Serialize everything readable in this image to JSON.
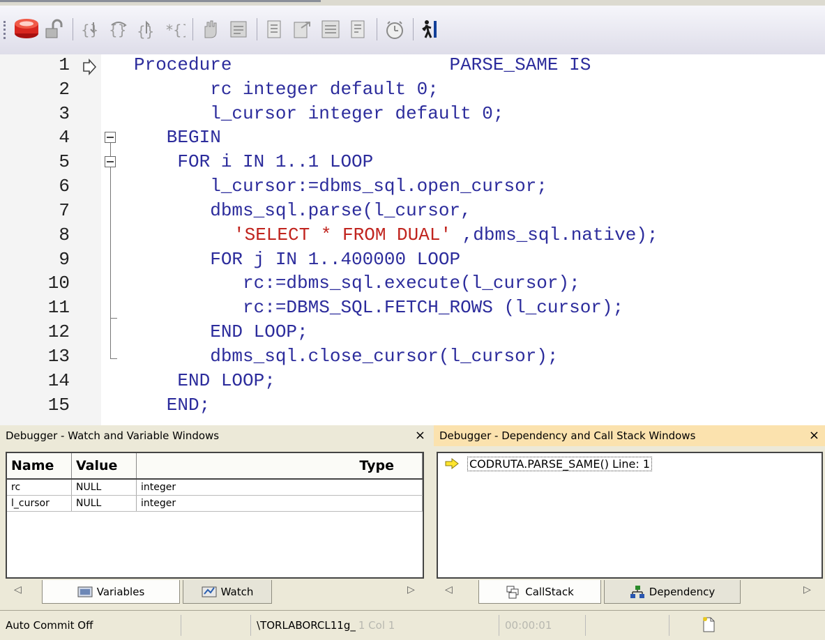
{
  "editor": {
    "lines": [
      {
        "num": "1",
        "text": "Procedure                    PARSE_SAME IS"
      },
      {
        "num": "2",
        "text": "       rc integer default 0;"
      },
      {
        "num": "3",
        "text": "       l_cursor integer default 0;"
      },
      {
        "num": "4",
        "text": "   BEGIN"
      },
      {
        "num": "5",
        "text": "    FOR i IN 1..1 LOOP"
      },
      {
        "num": "6",
        "text": "       l_cursor:=dbms_sql.open_cursor;"
      },
      {
        "num": "7",
        "text": "       dbms_sql.parse(l_cursor,"
      },
      {
        "num": "8",
        "string": "'SELECT * FROM DUAL'",
        "text": " ,dbms_sql.native);"
      },
      {
        "num": "9",
        "text": "       FOR j IN 1..400000 LOOP"
      },
      {
        "num": "10",
        "text": "          rc:=dbms_sql.execute(l_cursor);"
      },
      {
        "num": "11",
        "text": "          rc:=DBMS_SQL.FETCH_ROWS (l_cursor);"
      },
      {
        "num": "12",
        "text": "       END LOOP;"
      },
      {
        "num": "13",
        "text": "       dbms_sql.close_cursor(l_cursor);"
      },
      {
        "num": "14",
        "text": "    END LOOP;"
      },
      {
        "num": "15",
        "text": "   END;"
      }
    ]
  },
  "watch_panel": {
    "title": "Debugger  - Watch and Variable Windows",
    "close": "×",
    "columns": [
      "Name",
      "Value",
      "Type"
    ],
    "rows": [
      {
        "name": "rc",
        "value": "NULL",
        "type": "integer"
      },
      {
        "name": "l_cursor",
        "value": "NULL",
        "type": "integer"
      }
    ],
    "tabs": [
      "Variables",
      "Watch"
    ]
  },
  "callstack_panel": {
    "title": "Debugger - Dependency and Call Stack Windows",
    "close": "×",
    "entry": "CODRUTA.PARSE_SAME() Line: 1",
    "tabs": [
      "CallStack",
      "Dependency"
    ]
  },
  "status": {
    "commit": "Auto Commit Off",
    "connection": "\\TORLABORCL11g_",
    "position": "1 Col 1",
    "timer": "00:00:01"
  },
  "colors": {
    "keyword": "#2c2c9c",
    "string": "#c0241e",
    "panel_active_title": "#fbe2ae"
  }
}
